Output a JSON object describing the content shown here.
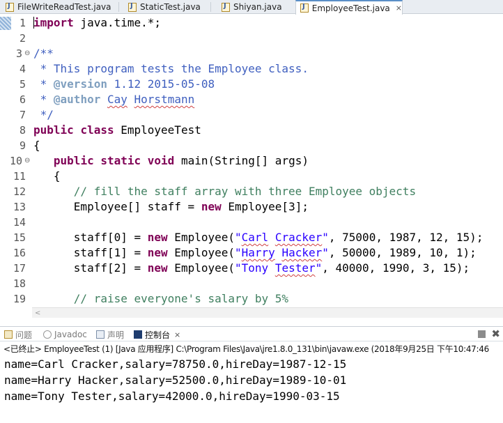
{
  "editor_tabs": [
    {
      "label": "FileWriteReadTest.java",
      "active": false
    },
    {
      "label": "StaticTest.java",
      "active": false
    },
    {
      "label": "Shiyan.java",
      "active": false
    },
    {
      "label": "EmployeeTest.java",
      "active": true
    }
  ],
  "tab_close_glyph": "⨯",
  "line_numbers": [
    "1",
    "2",
    "3",
    "4",
    "5",
    "6",
    "7",
    "8",
    "9",
    "10",
    "11",
    "12",
    "13",
    "14",
    "15",
    "16",
    "17",
    "18",
    "19"
  ],
  "fold_markers": {
    "line3": "⊖",
    "line10": "⊖"
  },
  "code": {
    "l1_kw": "import",
    "l1_rest": " java.time.*;",
    "l3": "/**",
    "l4": " * This program tests the Employee class.",
    "l5_star": " * ",
    "l5_tag": "@version",
    "l5_rest": " 1.12 2015-05-08",
    "l6_star": " * ",
    "l6_tag": "@author",
    "l6_sp": " ",
    "l6_name1": "Cay",
    "l6_sp2": " ",
    "l6_name2": "Horstmann",
    "l7": " */",
    "l8_kw1": "public",
    "l8_sp": " ",
    "l8_kw2": "class",
    "l8_rest": " EmployeeTest",
    "l9": "{",
    "l10_indent": "   ",
    "l10_kw1": "public",
    "l10_kw2": "static",
    "l10_kw3": "void",
    "l10_rest": " main(String[] args)",
    "l11": "   {",
    "l12": "      // fill the staff array with three Employee objects",
    "l13_a": "      Employee[] staff = ",
    "l13_kw": "new",
    "l13_b": " Employee[3];",
    "l15_a": "      staff[0] = ",
    "l15_kw": "new",
    "l15_b": " Employee(",
    "l15_q1": "\"",
    "l15_s1": "Carl",
    "l15_sp": " ",
    "l15_s2": "Cracker",
    "l15_q2": "\"",
    "l15_c": ", 75000, 1987, 12, 15);",
    "l16_a": "      staff[1] = ",
    "l16_kw": "new",
    "l16_b": " Employee(",
    "l16_q1": "\"",
    "l16_s1": "Harry",
    "l16_sp": " ",
    "l16_s2": "Hacker",
    "l16_q2": "\"",
    "l16_c": ", 50000, 1989, 10, 1);",
    "l17_a": "      staff[2] = ",
    "l17_kw": "new",
    "l17_b": " Employee(",
    "l17_q1": "\"",
    "l17_s1": "Tony",
    "l17_sp": " ",
    "l17_s2": "Tester",
    "l17_q2": "\"",
    "l17_c": ", 40000, 1990, 3, 15);",
    "l19": "      // raise everyone's salary by 5%"
  },
  "scroll_left_arrow": "<",
  "panel_tabs": [
    {
      "label": "问题",
      "icon": "problems-icon"
    },
    {
      "label": "Javadoc",
      "icon": "javadoc-icon"
    },
    {
      "label": "声明",
      "icon": "declaration-icon"
    },
    {
      "label": "控制台",
      "icon": "console-icon"
    }
  ],
  "console_close_glyph": "⨯",
  "panel_tool_x": "✖",
  "console_status": "<已终止> EmployeeTest (1) [Java 应用程序] C:\\Program Files\\Java\\jre1.8.0_131\\bin\\javaw.exe (2018年9月25日 下午10:47:46",
  "console_output": [
    "name=Carl Cracker,salary=78750.0,hireDay=1987-12-15",
    "name=Harry Hacker,salary=52500.0,hireDay=1989-10-01",
    "name=Tony Tester,salary=42000.0,hireDay=1990-03-15"
  ],
  "colors": {
    "keyword": "#7f0055",
    "string": "#2a00ff",
    "comment": "#3f7f5f",
    "javadoc": "#3f5fbf",
    "javadoc_tag": "#7f9fbf"
  }
}
